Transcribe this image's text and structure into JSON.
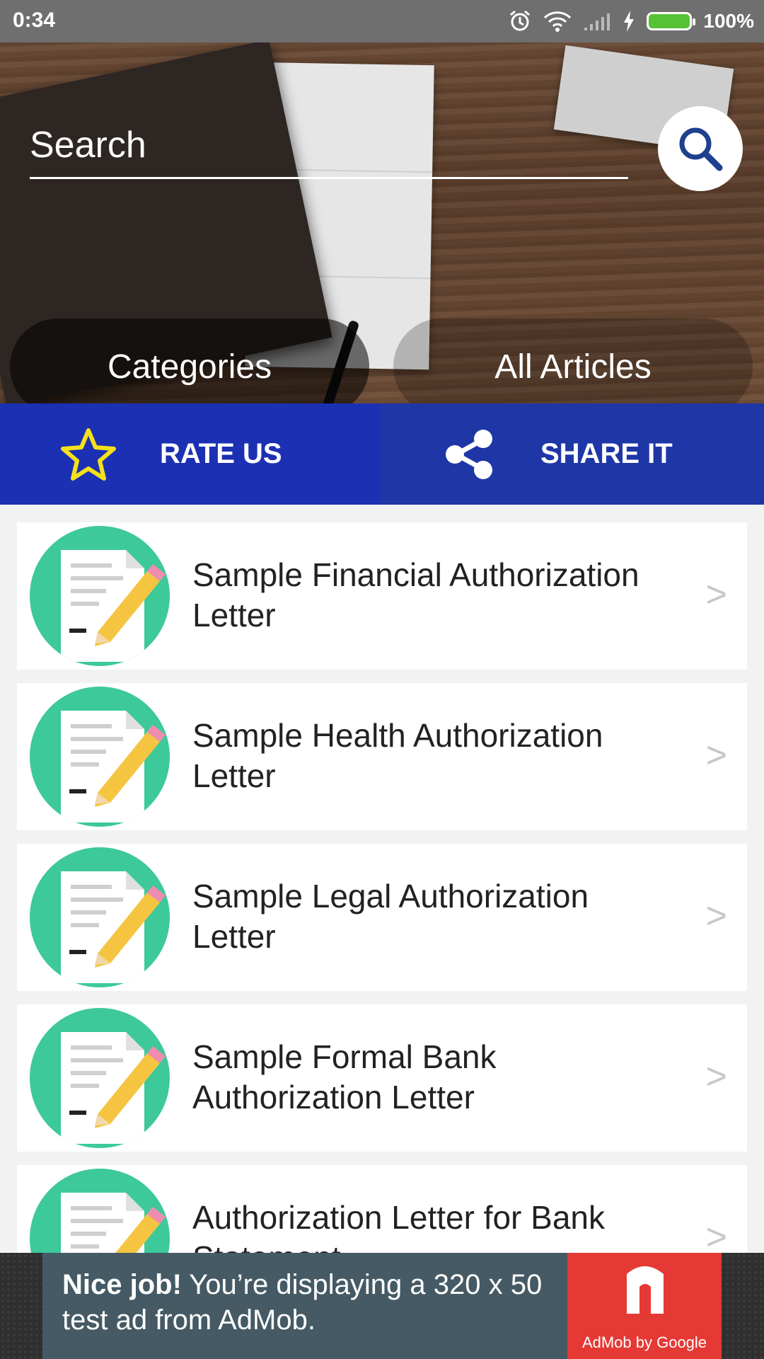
{
  "status_bar": {
    "time": "0:34",
    "battery": "100%"
  },
  "search": {
    "placeholder": "Search"
  },
  "tabs": {
    "categories": "Categories",
    "all_articles": "All Articles"
  },
  "actions": {
    "rate": "RATE US",
    "share": "SHARE IT"
  },
  "articles": [
    {
      "title_line1": "Sample Financial Authorization",
      "title_line2": "Letter"
    },
    {
      "title_line1": "Sample Health Authorization",
      "title_line2": "Letter"
    },
    {
      "title_line1": "Sample Legal Authorization",
      "title_line2": "Letter"
    },
    {
      "title_line1": "Sample Formal Bank",
      "title_line2": "Authorization Letter"
    },
    {
      "title_line1": "Authorization Letter for Bank",
      "title_line2": "Statement"
    }
  ],
  "chevron": ">",
  "ad": {
    "bold": "Nice job!",
    "text": " You’re displaying a 320 x 50 test ad from AdMob.",
    "brand": "AdMob by Google"
  },
  "colors": {
    "rate_bg": "#1c30b3",
    "share_bg": "#1f36a6",
    "thumb_bg": "#3dc99a",
    "star": "#f4e11a"
  }
}
